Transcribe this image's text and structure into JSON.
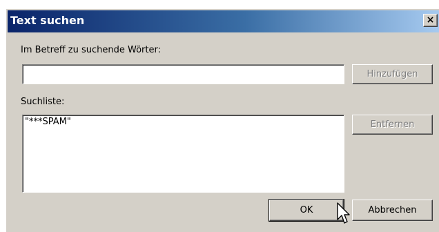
{
  "window": {
    "title": "Text suchen",
    "close_label": "×"
  },
  "form": {
    "words_label": "Im Betreff zu suchende Wörter:",
    "words_value": "",
    "list_label": "Suchliste:",
    "list_items": [
      "\"***SPAM\""
    ]
  },
  "buttons": {
    "add": "Hinzufügen",
    "remove": "Entfernen",
    "ok": "OK",
    "cancel": "Abbrechen"
  }
}
